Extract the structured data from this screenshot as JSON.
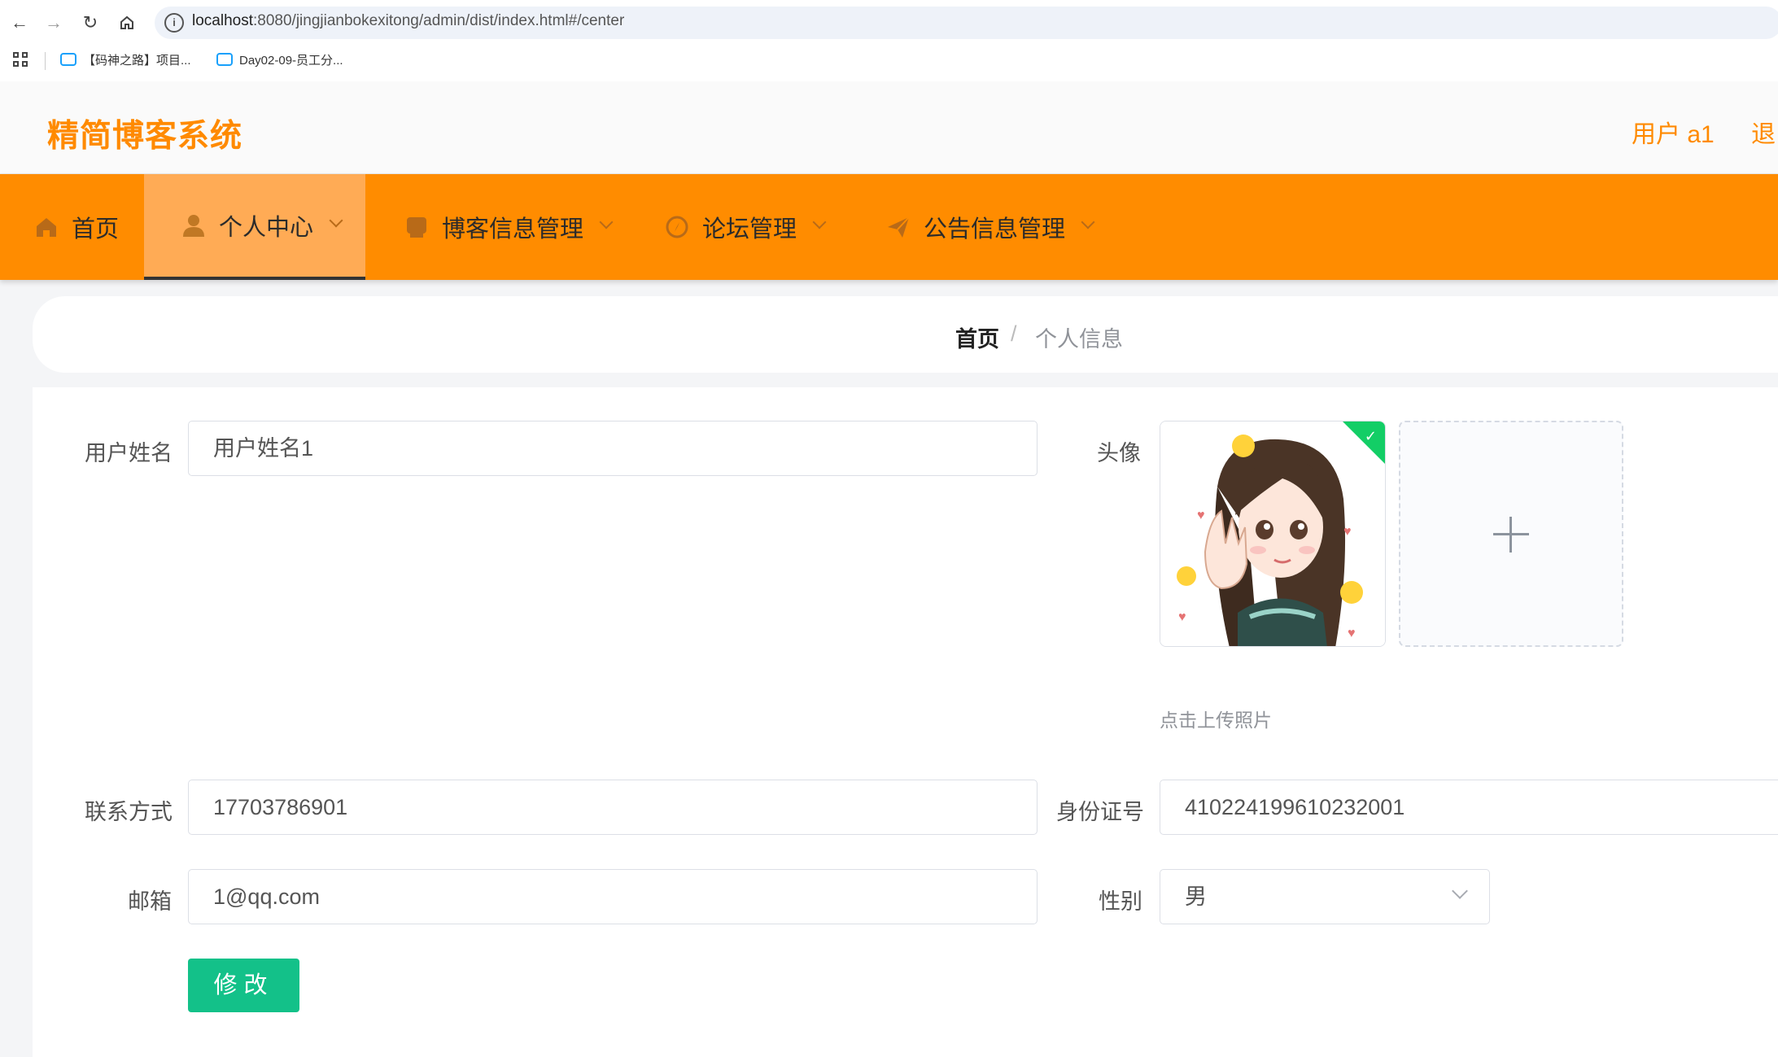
{
  "browser": {
    "url_host": "localhost",
    "url_rest": ":8080/jingjianbokexitong/admin/dist/index.html#/center",
    "bookmarks": [
      {
        "label": "【码神之路】项目..."
      },
      {
        "label": "Day02-09-员工分..."
      }
    ]
  },
  "header": {
    "title": "精简博客系统",
    "user_label": "用户 a1",
    "logout_label": "退"
  },
  "nav": {
    "items": [
      {
        "label": "首页",
        "icon": "home-icon"
      },
      {
        "label": "个人中心",
        "icon": "user-icon",
        "active": true
      },
      {
        "label": "博客信息管理",
        "icon": "blog-icon"
      },
      {
        "label": "论坛管理",
        "icon": "compass-icon"
      },
      {
        "label": "公告信息管理",
        "icon": "send-icon"
      }
    ]
  },
  "breadcrumb": {
    "home": "首页",
    "separator": "/",
    "current": "个人信息"
  },
  "form": {
    "name_label": "用户姓名",
    "name_value": "用户姓名1",
    "avatar_label": "头像",
    "upload_hint": "点击上传照片",
    "phone_label": "联系方式",
    "phone_value": "17703786901",
    "idcard_label": "身份证号",
    "idcard_value": "410224199610232001",
    "email_label": "邮箱",
    "email_value": "1@qq.com",
    "gender_label": "性别",
    "gender_value": "男",
    "submit_label": "修改"
  },
  "colors": {
    "brand": "#ff8a00",
    "nav_bg": "#ff8c00",
    "nav_active": "#ffab55",
    "submit": "#13c189",
    "success": "#13ce66"
  }
}
